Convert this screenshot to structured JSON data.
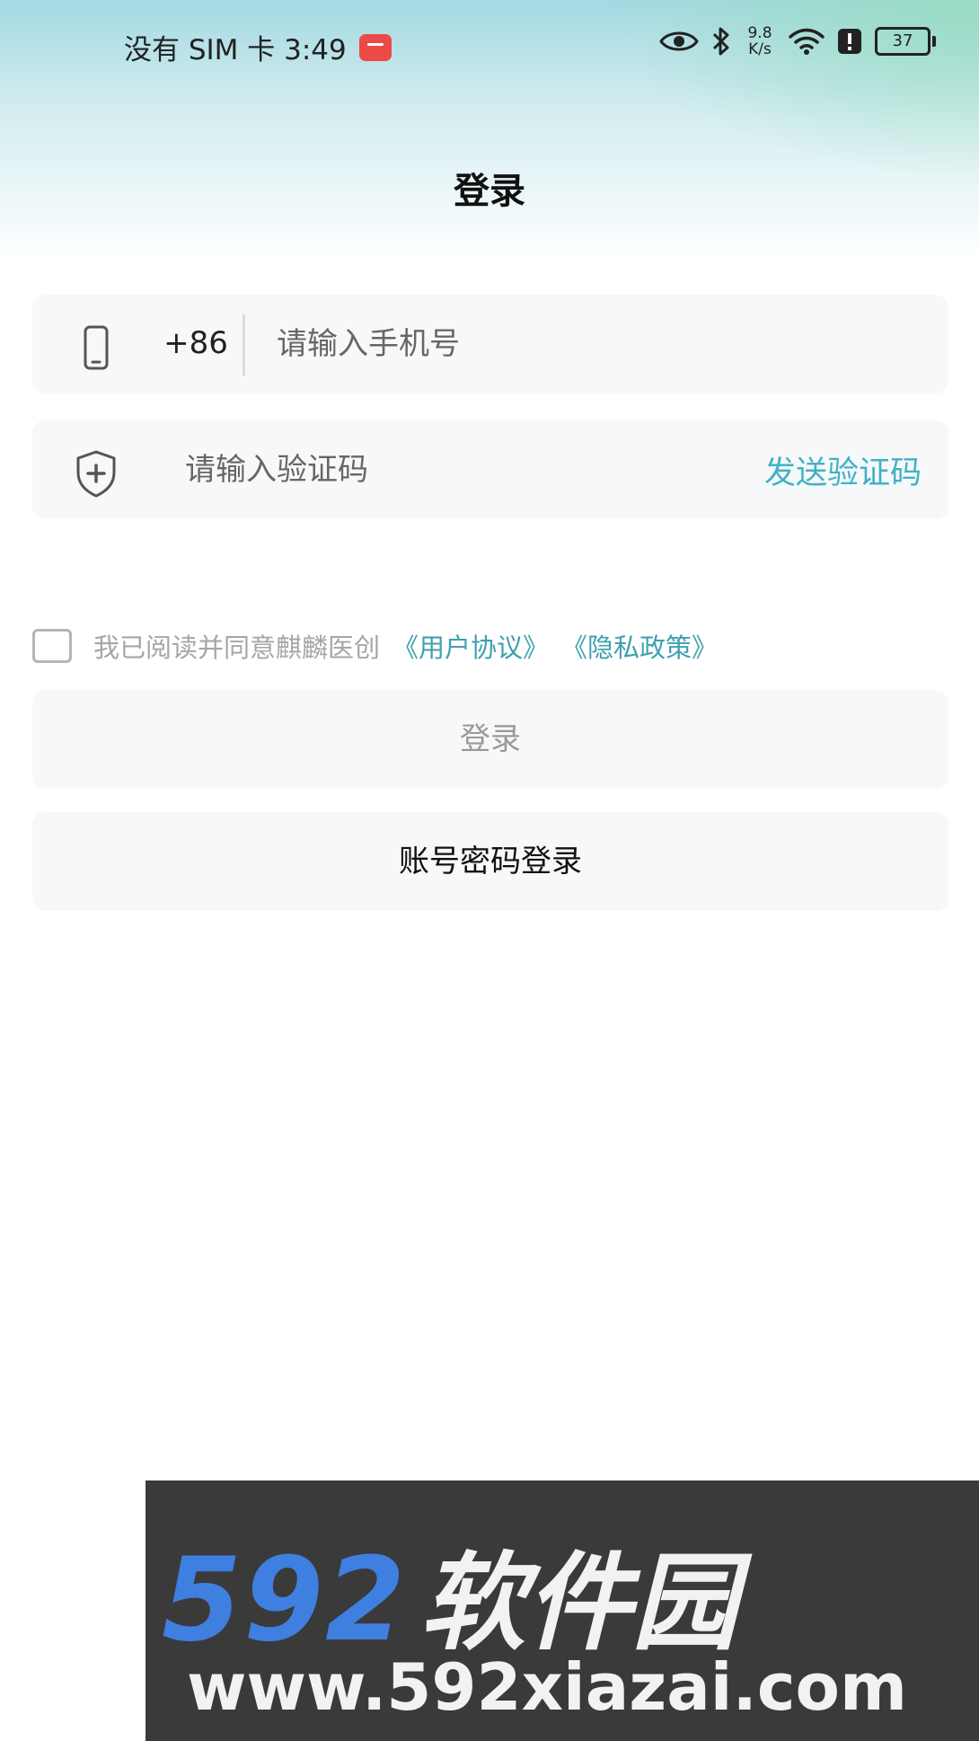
{
  "status_bar": {
    "carrier_time": "没有 SIM 卡 3:49",
    "net_speed_value": "9.8",
    "net_speed_unit": "K/s",
    "battery": "37",
    "icons": [
      "huawei-app-icon",
      "eye-icon",
      "bluetooth-icon",
      "wifi-icon",
      "alert-icon",
      "battery-icon"
    ]
  },
  "header": {
    "title": "登录"
  },
  "phone_field": {
    "country_code": "+86",
    "placeholder": "请输入手机号",
    "value": ""
  },
  "code_field": {
    "placeholder": "请输入验证码",
    "value": "",
    "send_label": "发送验证码"
  },
  "agreement": {
    "text": "我已阅读并同意麒麟医创",
    "user_agreement": "《用户协议》",
    "privacy_policy": "《隐私政策》",
    "checked": false
  },
  "buttons": {
    "login": "登录",
    "account_login": "账号密码登录"
  },
  "watermark": {
    "brand_number": "592",
    "brand_name": "软件园",
    "url": "www.592xiazai.com"
  },
  "colors": {
    "accent": "#3fb2c4",
    "field_bg": "#f7f8fa",
    "watermark_bg": "#3a3a3b",
    "watermark_blue": "#3f7fe0"
  }
}
